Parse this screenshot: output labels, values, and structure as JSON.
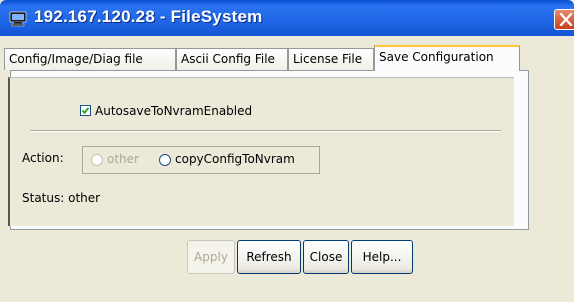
{
  "window": {
    "title": "192.167.120.28 - FileSystem"
  },
  "tabs": [
    {
      "label": "Config/Image/Diag file",
      "active": false
    },
    {
      "label": "Ascii Config File",
      "active": false
    },
    {
      "label": "License File",
      "active": false
    },
    {
      "label": "Save Configuration",
      "active": true
    }
  ],
  "form": {
    "autosave": {
      "label": "AutosaveToNvramEnabled",
      "checked": true
    },
    "action": {
      "label": "Action:",
      "options": [
        {
          "label": "other",
          "selected": false,
          "disabled": true
        },
        {
          "label": "copyConfigToNvram",
          "selected": false,
          "disabled": false
        }
      ]
    },
    "status": {
      "label": "Status:",
      "value": "other"
    }
  },
  "buttons": {
    "apply": "Apply",
    "refresh": "Refresh",
    "close": "Close",
    "help": "Help..."
  },
  "colors": {
    "titlebar": "#1f66e6",
    "window_bg": "#ece9d8",
    "close_btn": "#c8401f",
    "active_tab_highlight": "#ffc83c"
  },
  "icons": {
    "title": "computer-icon",
    "close": "close-icon"
  }
}
